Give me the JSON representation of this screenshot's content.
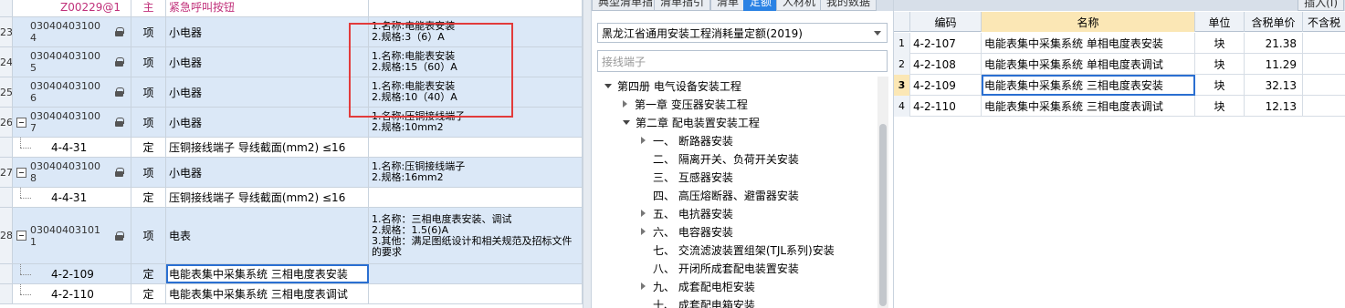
{
  "left_grid": {
    "rows": [
      {
        "num": "",
        "code": "Z00229@1",
        "type": "主",
        "name": "紧急呼叫按钮",
        "features": [],
        "kind": "top"
      },
      {
        "num": "23",
        "code1": "03040403100",
        "code2": "4",
        "type": "项",
        "name": "小电器",
        "features": [
          "1.名称:电能表安装",
          "2.规格:3（6）A"
        ],
        "kind": "item"
      },
      {
        "num": "24",
        "code1": "03040403100",
        "code2": "5",
        "type": "项",
        "name": "小电器",
        "features": [
          "1.名称:电能表安装",
          "2.规格:15（60）A"
        ],
        "kind": "item"
      },
      {
        "num": "25",
        "code1": "03040403100",
        "code2": "6",
        "type": "项",
        "name": "小电器",
        "features": [
          "1.名称:电能表安装",
          "2.规格:10（40）A"
        ],
        "kind": "item"
      },
      {
        "num": "26",
        "code1": "03040403100",
        "code2": "7",
        "type": "项",
        "name": "小电器",
        "features": [
          "1.名称:压铜接线端子",
          "2.规格:10mm2"
        ],
        "kind": "item-exp"
      },
      {
        "num": "",
        "code": "4-4-31",
        "type": "定",
        "name": "压铜接线端子 导线截面(mm2) ≤16",
        "features": [],
        "kind": "sub"
      },
      {
        "num": "27",
        "code1": "03040403100",
        "code2": "8",
        "type": "项",
        "name": "小电器",
        "features": [
          "1.名称:压铜接线端子",
          "2.规格:16mm2"
        ],
        "kind": "item-exp"
      },
      {
        "num": "",
        "code": "4-4-31",
        "type": "定",
        "name": "压铜接线端子 导线截面(mm2) ≤16",
        "features": [],
        "kind": "sub"
      },
      {
        "num": "28",
        "code1": "03040403101",
        "code2": "1",
        "type": "项",
        "name": "电表",
        "features": [
          "1.名称：三相电度表安装、调试",
          "2.规格：1.5(6)A",
          "3.其他：满足图纸设计和相关规范及招标文件的要求"
        ],
        "kind": "item-exp-tall"
      },
      {
        "num": "",
        "code": "4-2-109",
        "type": "定",
        "name": "电能表集中采集系统 三相电度表安装",
        "features": [],
        "kind": "sub-sel"
      },
      {
        "num": "",
        "code": "4-2-110",
        "type": "定",
        "name": "电能表集中采集系统 三相电度表调试",
        "features": [],
        "kind": "sub"
      }
    ]
  },
  "middle": {
    "tabs": [
      "典型清单指引",
      "清单指引",
      "清单",
      "定额",
      "人材机",
      "我的数据"
    ],
    "active_tab": "定额",
    "quota_library": "黑龙江省通用安装工程消耗量定额(2019)",
    "search_value": "接线端子",
    "tree": [
      {
        "label": "第四册 电气设备安装工程",
        "level": 0,
        "state": "open"
      },
      {
        "label": "第一章 变压器安装工程",
        "level": 1,
        "state": "closed"
      },
      {
        "label": "第二章 配电装置安装工程",
        "level": 1,
        "state": "open"
      },
      {
        "label": "一、 断路器安装",
        "level": 2,
        "state": "closed"
      },
      {
        "label": "二、 隔离开关、负荷开关安装",
        "level": 2,
        "state": "none"
      },
      {
        "label": "三、 互感器安装",
        "level": 2,
        "state": "none"
      },
      {
        "label": "四、 高压熔断器、避雷器安装",
        "level": 2,
        "state": "none"
      },
      {
        "label": "五、 电抗器安装",
        "level": 2,
        "state": "closed"
      },
      {
        "label": "六、 电容器安装",
        "level": 2,
        "state": "closed"
      },
      {
        "label": "七、 交流滤波装置组架(TJL系列)安装",
        "level": 2,
        "state": "none"
      },
      {
        "label": "八、 开闭所成套配电装置安装",
        "level": 2,
        "state": "none"
      },
      {
        "label": "九、 成套配电柜安装",
        "level": 2,
        "state": "closed"
      },
      {
        "label": "十、 成套配电箱安装",
        "level": 2,
        "state": "none"
      }
    ]
  },
  "right": {
    "tabs": [
      "插入(I)"
    ],
    "columns": [
      "编码",
      "名称",
      "单位",
      "含税单价",
      "不含税"
    ],
    "rows": [
      {
        "num": "1",
        "code": "4-2-107",
        "name": "电能表集中采集系统 单相电度表安装",
        "unit": "块",
        "price": "21.38"
      },
      {
        "num": "2",
        "code": "4-2-108",
        "name": "电能表集中采集系统 单相电度表调试",
        "unit": "块",
        "price": "11.29"
      },
      {
        "num": "3",
        "code": "4-2-109",
        "name": "电能表集中采集系统 三相电度表安装",
        "unit": "块",
        "price": "32.13"
      },
      {
        "num": "4",
        "code": "4-2-110",
        "name": "电能表集中采集系统 三相电度表调试",
        "unit": "块",
        "price": "12.13"
      }
    ],
    "selected_row": 2
  },
  "colors": {
    "highlight_box": "#e23b3b",
    "row_blue": "#dbe8f7",
    "active_tab": "#2a82e4",
    "header_highlight": "#fbe7b5"
  }
}
